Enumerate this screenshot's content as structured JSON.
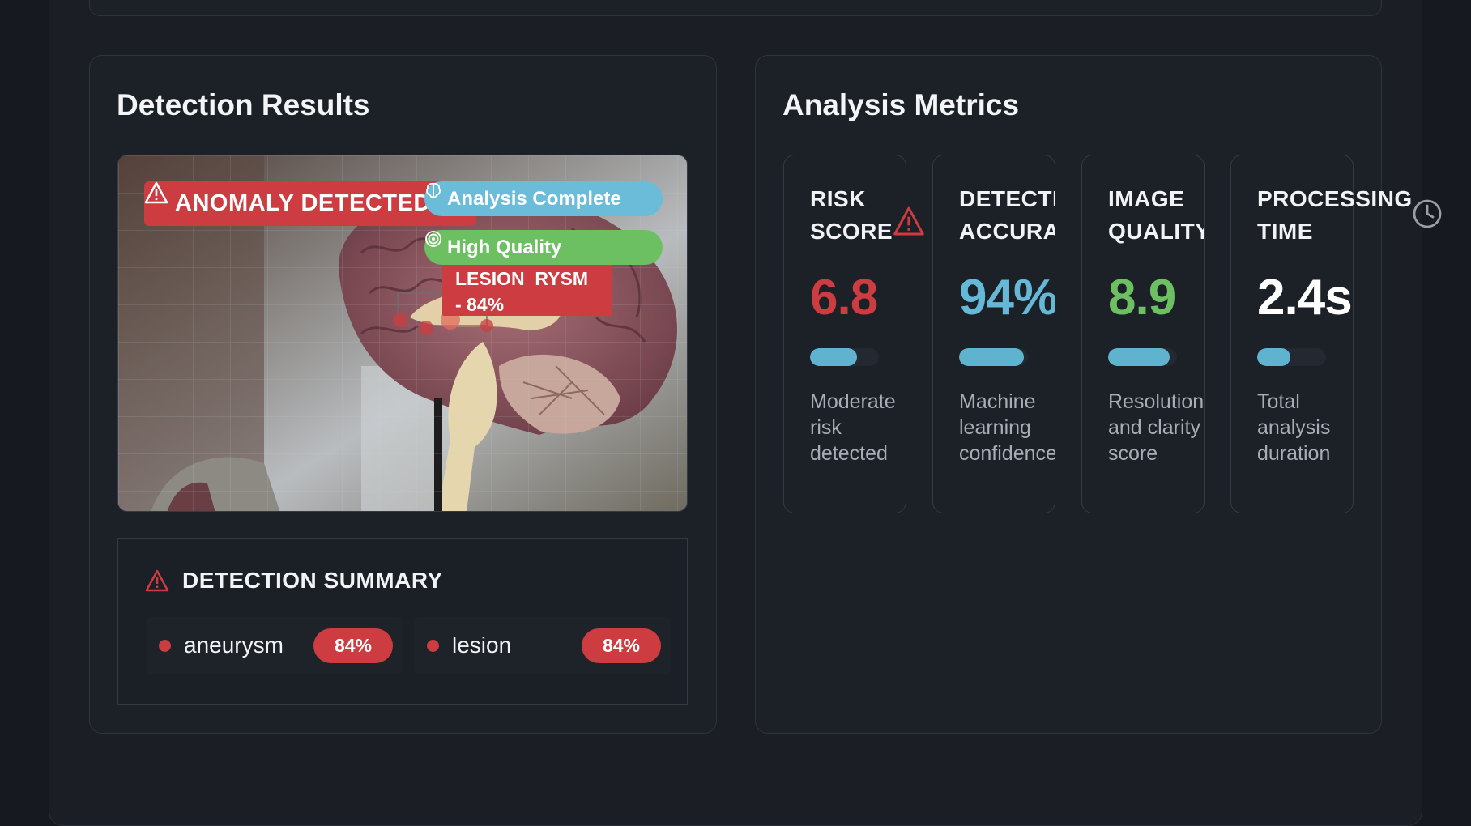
{
  "detection": {
    "title": "Detection Results",
    "anomaly_badge": "ANOMALY DETECTED",
    "analysis_badge": "Analysis Complete",
    "quality_badge": "High Quality",
    "lesion_label_line1": "LESION",
    "lesion_label_line1b": "RYSM",
    "lesion_label_line2": "- 84%",
    "summary": {
      "title": "DETECTION SUMMARY",
      "items": [
        {
          "name": "aneurysm",
          "confidence": "84%"
        },
        {
          "name": "lesion",
          "confidence": "84%"
        }
      ]
    }
  },
  "metrics": {
    "title": "Analysis Metrics",
    "cards": [
      {
        "label_line1": "RISK",
        "label_line2": "SCORE",
        "value": "6.8",
        "value_color": "#cc3c40",
        "progress": 0.68,
        "description": "Moderate risk detected",
        "icon": "warning-icon"
      },
      {
        "label_line1": "DETECTION",
        "label_line2": "ACCURACY",
        "value": "94%",
        "value_color": "#66b9d6",
        "progress": 0.94,
        "description": "Machine learning confidence",
        "icon": "target-icon"
      },
      {
        "label_line1": "IMAGE",
        "label_line2": "QUALITY",
        "value": "8.9",
        "value_color": "#6cc062",
        "progress": 0.89,
        "description": "Resolution and clarity score",
        "icon": "eye-icon"
      },
      {
        "label_line1": "PROCESSING",
        "label_line2": "TIME",
        "value": "2.4s",
        "value_color": "#ffffff",
        "progress": 0.48,
        "description": "Total analysis duration",
        "icon": "clock-icon"
      }
    ]
  },
  "colors": {
    "danger": "#cc3c40",
    "info": "#6bbcd8",
    "success": "#6cc062",
    "background": "#1b1e25"
  }
}
